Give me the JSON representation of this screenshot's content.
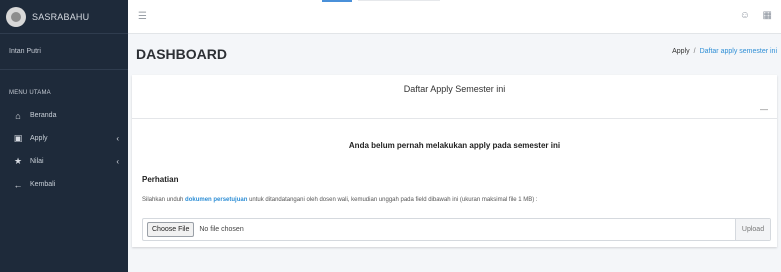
{
  "brand": {
    "name": "SASRABAHU"
  },
  "user": {
    "name": "Intan Putri"
  },
  "menu": {
    "heading": "MENU UTAMA",
    "items": [
      {
        "label": "Beranda",
        "icon": "home-icon"
      },
      {
        "label": "Apply",
        "icon": "file-icon",
        "has_submenu": true
      },
      {
        "label": "Nilai",
        "icon": "star-icon",
        "has_submenu": true
      },
      {
        "label": "Kembali",
        "icon": "arrow-left-icon"
      }
    ]
  },
  "topbar": {
    "menu_icon": "hamburger-icon",
    "user_icon": "user-icon",
    "grid_icon": "grid-icon"
  },
  "page": {
    "title": "DASHBOARD",
    "breadcrumb": {
      "parent": "Apply",
      "separator": "/",
      "current": "Daftar apply semester ini"
    }
  },
  "card": {
    "title": "Daftar Apply Semester ini",
    "collapse_symbol": "—",
    "message": "Anda belum pernah melakukan apply pada semester ini",
    "attention_heading": "Perhatian",
    "note_prefix": "Silahkan unduh",
    "note_link": "dokumen persetujuan",
    "note_suffix": "untuk ditandatangani oleh dosen wali, kemudian unggah pada field dibawah ini (ukuran maksimal file 1 MB) :",
    "choose_label": "Choose File",
    "file_status": "No file chosen",
    "upload_label": "Upload"
  },
  "colors": {
    "sidebar": "#1e2a3a",
    "link": "#2f8fd6",
    "background": "#f4f6f9"
  }
}
